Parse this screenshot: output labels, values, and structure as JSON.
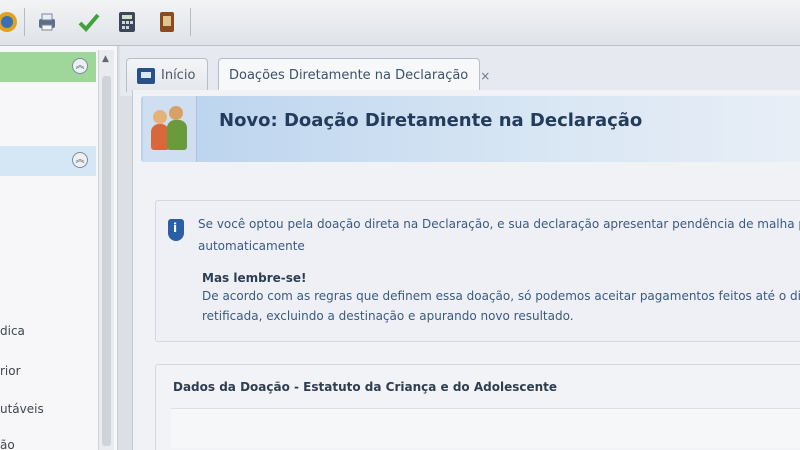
{
  "toolbar": {
    "icons": [
      "app-icon",
      "print-icon",
      "check-icon",
      "calculator-icon",
      "book-icon"
    ]
  },
  "sidebar": {
    "labels": [
      "dica",
      "rior",
      "utáveis",
      "ão"
    ]
  },
  "tabs": [
    {
      "label": "Início"
    },
    {
      "label": "Doações Diretamente na Declaração",
      "close": "×"
    }
  ],
  "banner": {
    "title": "Novo: Doação Diretamente na Declaração"
  },
  "info": {
    "line1": "Se você optou pela doação direta na Declaração, e sua declaração apresentar pendência de malha por co",
    "line2": "automaticamente",
    "bold": "Mas lembre-se!",
    "line3": "De acordo com as regras que definem essa doação, só podemos aceitar pagamentos feitos até o dia de",
    "line4": "retificada, excluindo a destinação e apurando novo resultado."
  },
  "section": {
    "title": "Dados da Doação - Estatuto da Criança e do Adolescente"
  },
  "colors": {
    "active_sidebar": "#9fd69a",
    "banner": "#b9d2ee",
    "title": "#243c5c"
  }
}
